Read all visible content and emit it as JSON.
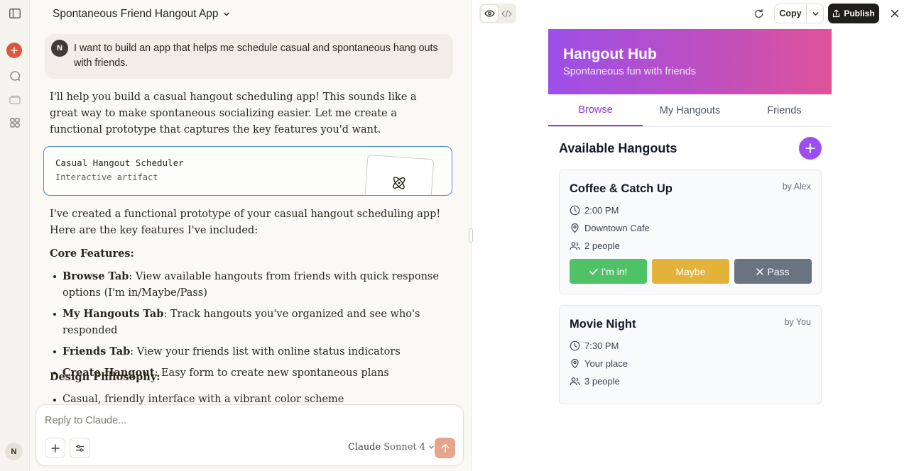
{
  "chat": {
    "title": "Spontaneous Friend Hangout App",
    "user_initial": "N",
    "user_message": "I want to build an app that helps me schedule casual and spontaneous hang outs with friends.",
    "intro": "I'll help you build a casual hangout scheduling app! This sounds like a great way to make spontaneous socializing easier. Let me create a functional prototype that captures the key features you'd want.",
    "artifact": {
      "title": "Casual Hangout Scheduler",
      "subtitle": "Interactive artifact"
    },
    "summary": "I've created a functional prototype of your casual hangout scheduling app! Here are the key features I've included:",
    "core_heading": "Core Features:",
    "features": [
      {
        "name": "Browse Tab",
        "desc": ": View available hangouts from friends with quick response options (I'm in/Maybe/Pass)"
      },
      {
        "name": "My Hangouts Tab",
        "desc": ": Track hangouts you've organized and see who's responded"
      },
      {
        "name": "Friends Tab",
        "desc": ": View your friends list with online status indicators"
      },
      {
        "name": "Create Hangout",
        "desc": ": Easy form to create new spontaneous plans"
      }
    ],
    "design_heading": "Design Philosophy:",
    "design_points": [
      "Casual, friendly interface with a vibrant color scheme"
    ],
    "composer_placeholder": "Reply to Claude...",
    "model_brand": "Claude",
    "model_name": "Sonnet 4",
    "account_initial": "N"
  },
  "toolbar": {
    "copy_label": "Copy",
    "publish_label": "Publish"
  },
  "app": {
    "title": "Hangout Hub",
    "subtitle": "Spontaneous fun with friends",
    "tabs": [
      "Browse",
      "My Hangouts",
      "Friends"
    ],
    "section_title": "Available Hangouts",
    "hangouts": [
      {
        "title": "Coffee & Catch Up",
        "by": "by Alex",
        "time": "2:00 PM",
        "place": "Downtown Cafe",
        "people": "2 people"
      },
      {
        "title": "Movie Night",
        "by": "by You",
        "time": "7:30 PM",
        "place": "Your place",
        "people": "3 people"
      }
    ],
    "responses": {
      "in": "I'm in!",
      "maybe": "Maybe",
      "pass": "Pass"
    }
  },
  "colors": {
    "accent_orange": "#d9583e",
    "header_gradient_start": "#9c4fe8",
    "header_gradient_end": "#e0529a",
    "active_tab": "#9333ea",
    "im_in": "#4fc167",
    "maybe": "#e2b23a",
    "pass": "#6b7280"
  }
}
